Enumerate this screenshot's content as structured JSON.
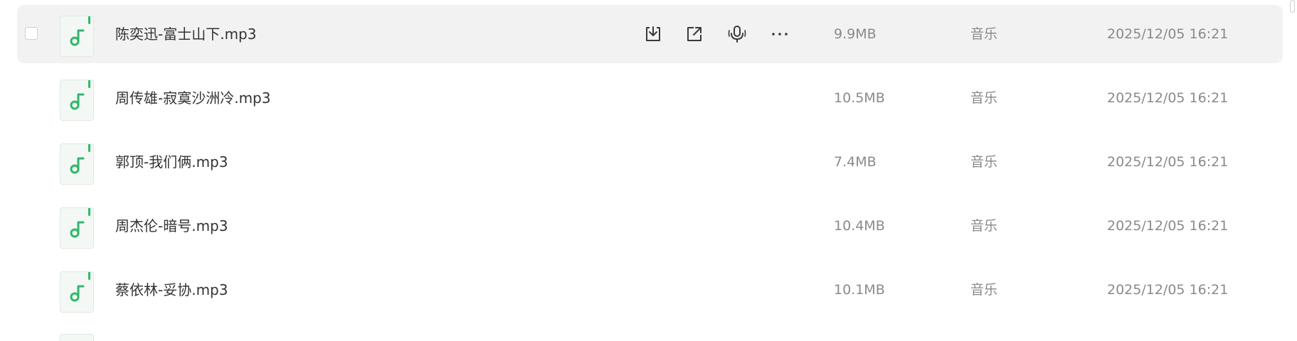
{
  "colors": {
    "accent": "#2eb86c",
    "hover_row": "#f2f2f2",
    "meta_text": "#8a8a8a",
    "name_text": "#333333"
  },
  "row_actions": [
    {
      "icon": "download-icon"
    },
    {
      "icon": "share-icon"
    },
    {
      "icon": "voice-icon"
    },
    {
      "icon": "more-icon"
    }
  ],
  "files": [
    {
      "name": "陈奕迅-富士山下.mp3",
      "size": "9.9MB",
      "type": "音乐",
      "date": "2025/12/05 16:21",
      "icon": "music-note-icon",
      "hovered": true
    },
    {
      "name": "周传雄-寂寞沙洲冷.mp3",
      "size": "10.5MB",
      "type": "音乐",
      "date": "2025/12/05 16:21",
      "icon": "music-note-icon"
    },
    {
      "name": "郭顶-我们俩.mp3",
      "size": "7.4MB",
      "type": "音乐",
      "date": "2025/12/05 16:21",
      "icon": "music-note-icon"
    },
    {
      "name": "周杰伦-暗号.mp3",
      "size": "10.4MB",
      "type": "音乐",
      "date": "2025/12/05 16:21",
      "icon": "music-note-icon"
    },
    {
      "name": "蔡依林-妥协.mp3",
      "size": "10.1MB",
      "type": "音乐",
      "date": "2025/12/05 16:21",
      "icon": "music-note-icon"
    }
  ]
}
